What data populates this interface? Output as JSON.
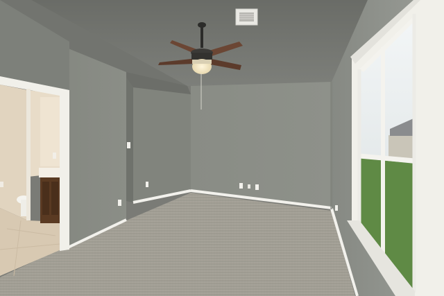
{
  "scene": {
    "kind": "interior-photo",
    "subject": "empty bedroom",
    "objects": [
      "ceiling-fan",
      "hvac-vent",
      "window",
      "ensuite-bathroom-doorway",
      "carpet",
      "baseboards",
      "wall-outlets",
      "light-switches"
    ],
    "colors": {
      "wall": "#8f928b",
      "wall_shadow": "#7a7d77",
      "ceiling": "#6f716c",
      "carpet": "#a29f95",
      "trim": "#f2f1ec",
      "fan_blade": "#6b4634",
      "bath_wall": "#e3d6c2",
      "vanity": "#5a3a22",
      "tile": "#d9cbb6",
      "window_light": "#e9eef0",
      "lawn": "#5f8a45"
    }
  }
}
